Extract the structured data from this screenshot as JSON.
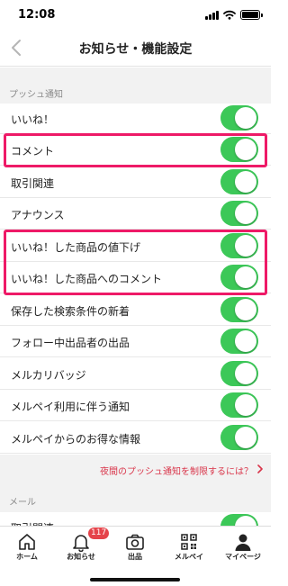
{
  "status_bar": {
    "time": "12:08"
  },
  "nav": {
    "title": "お知らせ・機能設定"
  },
  "sections": {
    "push": {
      "header": "プッシュ通知"
    },
    "mail": {
      "header": "メール"
    }
  },
  "push_items": [
    {
      "label": "いいね！",
      "on": true
    },
    {
      "label": "コメント",
      "on": true
    },
    {
      "label": "取引関連",
      "on": true
    },
    {
      "label": "アナウンス",
      "on": true
    },
    {
      "label": "いいね！した商品の値下げ",
      "on": true
    },
    {
      "label": "いいね！した商品へのコメント",
      "on": true
    },
    {
      "label": "保存した検索条件の新着",
      "on": true
    },
    {
      "label": "フォロー中出品者の出品",
      "on": true
    },
    {
      "label": "メルカリバッジ",
      "on": true
    },
    {
      "label": "メルペイ利用に伴う通知",
      "on": true
    },
    {
      "label": "メルペイからのお得な情報",
      "on": true
    }
  ],
  "night_link": "夜間のプッシュ通知を制限するには？",
  "mail_items": [
    {
      "label": "取引関連",
      "on": true
    }
  ],
  "tab_bar": {
    "tabs": [
      {
        "label": "ホーム",
        "icon": "home-icon"
      },
      {
        "label": "お知らせ",
        "icon": "bell-icon"
      },
      {
        "label": "出品",
        "icon": "camera-icon"
      },
      {
        "label": "メルペイ",
        "icon": "qr-code-icon"
      },
      {
        "label": "マイページ",
        "icon": "person-icon"
      }
    ],
    "notification_badge": "117"
  },
  "colors": {
    "toggle_on": "#3cc858",
    "highlight": "#ee1a67",
    "link": "#d9354a",
    "badge": "#e5434a"
  }
}
